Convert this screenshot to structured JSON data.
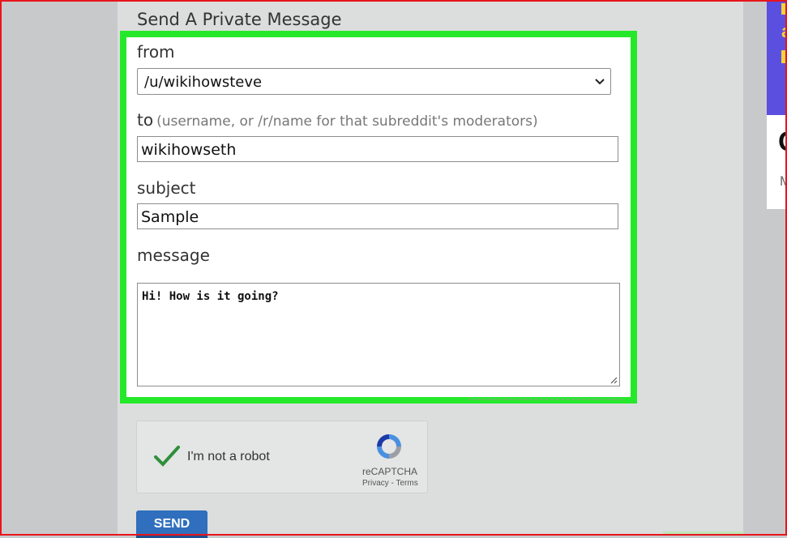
{
  "form": {
    "heading": "Send A Private Message",
    "from": {
      "label": "from",
      "value": "/u/wikihowsteve"
    },
    "to": {
      "label": "to",
      "hint": "(username, or /r/name for that subreddit's moderators)",
      "value": "wikihowseth"
    },
    "subject": {
      "label": "subject",
      "value": "Sample"
    },
    "message": {
      "label": "message",
      "value": "Hi! How is it going?"
    }
  },
  "recaptcha": {
    "label": "I'm not a robot",
    "brand": "reCAPTCHA",
    "links": "Privacy - Terms"
  },
  "send_button": {
    "label": "SEND"
  },
  "ad": {
    "title_char": "C",
    "sub_char": "M",
    "glyph": "a"
  },
  "colors": {
    "highlight": "#25e82b",
    "button": "#2f6fbd",
    "frame": "#e8141c"
  }
}
